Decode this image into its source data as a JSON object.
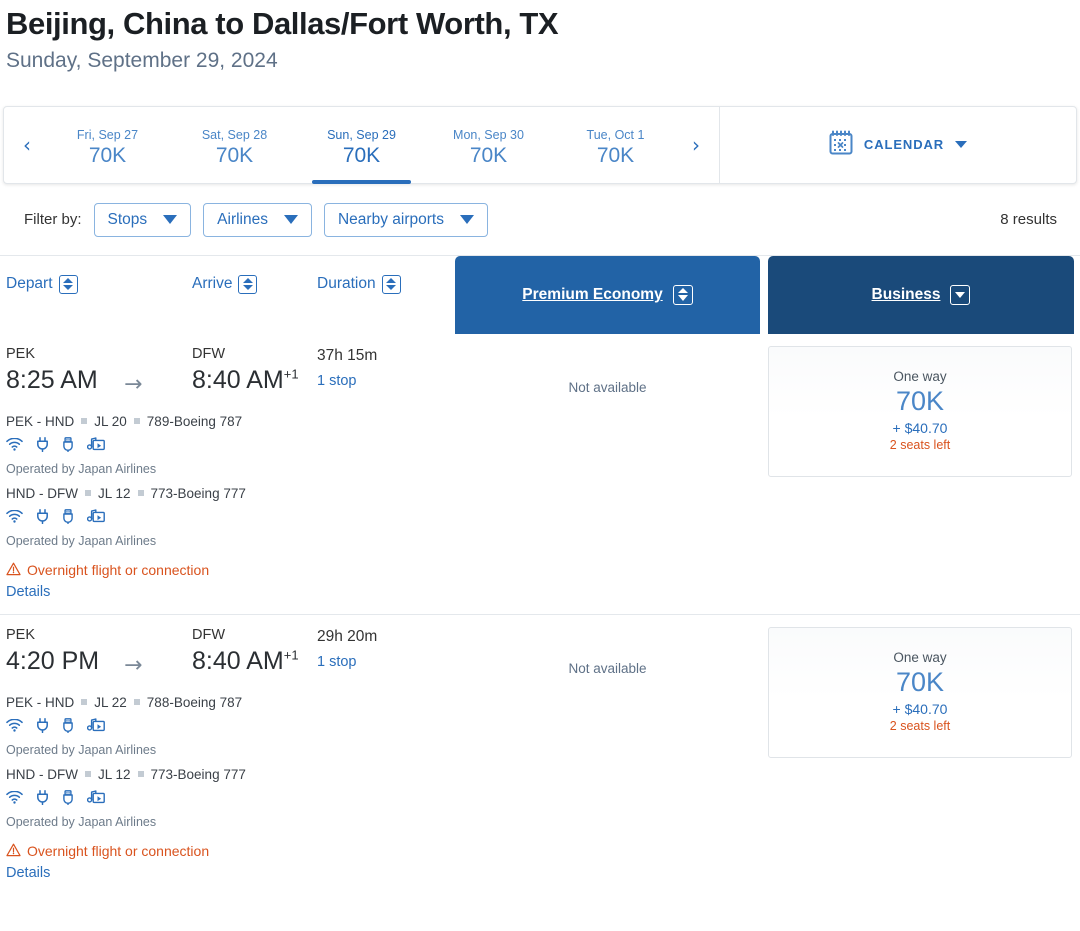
{
  "header": {
    "title": "Beijing, China to Dallas/Fort Worth, TX",
    "subtitle": "Sunday, September 29, 2024"
  },
  "date_strip": {
    "prev_icon": "‹",
    "next_icon": "›",
    "dates": [
      {
        "label": "Fri, Sep 27",
        "price": "70K",
        "selected": false
      },
      {
        "label": "Sat, Sep 28",
        "price": "70K",
        "selected": false
      },
      {
        "label": "Sun, Sep 29",
        "price": "70K",
        "selected": true
      },
      {
        "label": "Mon, Sep 30",
        "price": "70K",
        "selected": false
      },
      {
        "label": "Tue, Oct 1",
        "price": "70K",
        "selected": false
      }
    ],
    "calendar_button": {
      "label": "CALENDAR",
      "icon": "calendar-icon",
      "caret": "chevron-down-icon"
    }
  },
  "filters": {
    "label": "Filter by:",
    "buttons": [
      {
        "label": "Stops"
      },
      {
        "label": "Airlines"
      },
      {
        "label": "Nearby airports"
      }
    ],
    "results_count": "8 results"
  },
  "table": {
    "sort_headers": [
      {
        "label": "Depart"
      },
      {
        "label": "Arrive"
      },
      {
        "label": "Duration"
      }
    ],
    "cabins": [
      {
        "label": "Premium Economy",
        "color": "#2263a6",
        "sort_icon": "sort-updown-icon"
      },
      {
        "label": "Business",
        "color": "#1a4a7a",
        "sort_icon": "chevron-down-icon"
      }
    ]
  },
  "flights": [
    {
      "depart_airport": "PEK",
      "depart_time": "8:25 AM",
      "arrive_airport": "DFW",
      "arrive_time": "8:40 AM",
      "arrive_day_offset": "+1",
      "duration": "37h 15m",
      "stops": "1 stop",
      "segments": [
        {
          "route": "PEK - HND",
          "flight_number": "JL 20",
          "aircraft": "789-Boeing 787",
          "amenities": [
            "wifi-icon",
            "power-outlet-icon",
            "usb-port-icon",
            "entertainment-icon"
          ],
          "operated_by": "Operated by Japan Airlines"
        },
        {
          "route": "HND - DFW",
          "flight_number": "JL 12",
          "aircraft": "773-Boeing 777",
          "amenities": [
            "wifi-icon",
            "power-outlet-icon",
            "usb-port-icon",
            "entertainment-icon"
          ],
          "operated_by": "Operated by Japan Airlines"
        }
      ],
      "warning": "Overnight flight or connection",
      "details_label": "Details",
      "premium_economy": {
        "available": false,
        "text": "Not available"
      },
      "business": {
        "available": true,
        "trip_type": "One way",
        "points": "70K",
        "taxes": "+ $40.70",
        "seats_left": "2 seats left"
      }
    },
    {
      "depart_airport": "PEK",
      "depart_time": "4:20 PM",
      "arrive_airport": "DFW",
      "arrive_time": "8:40 AM",
      "arrive_day_offset": "+1",
      "duration": "29h 20m",
      "stops": "1 stop",
      "segments": [
        {
          "route": "PEK - HND",
          "flight_number": "JL 22",
          "aircraft": "788-Boeing 787",
          "amenities": [
            "wifi-icon",
            "power-outlet-icon",
            "usb-port-icon",
            "entertainment-icon"
          ],
          "operated_by": "Operated by Japan Airlines"
        },
        {
          "route": "HND - DFW",
          "flight_number": "JL 12",
          "aircraft": "773-Boeing 777",
          "amenities": [
            "wifi-icon",
            "power-outlet-icon",
            "usb-port-icon",
            "entertainment-icon"
          ],
          "operated_by": "Operated by Japan Airlines"
        }
      ],
      "warning": "Overnight flight or connection",
      "details_label": "Details",
      "premium_economy": {
        "available": false,
        "text": "Not available"
      },
      "business": {
        "available": true,
        "trip_type": "One way",
        "points": "70K",
        "taxes": "+ $40.70",
        "seats_left": "2 seats left"
      }
    }
  ],
  "colors": {
    "link_blue": "#2a6ebb",
    "light_blue": "#4a86c7",
    "premium_economy_blue": "#2263a6",
    "business_navy": "#1a4a7a",
    "warning_orange": "#d9531e"
  }
}
